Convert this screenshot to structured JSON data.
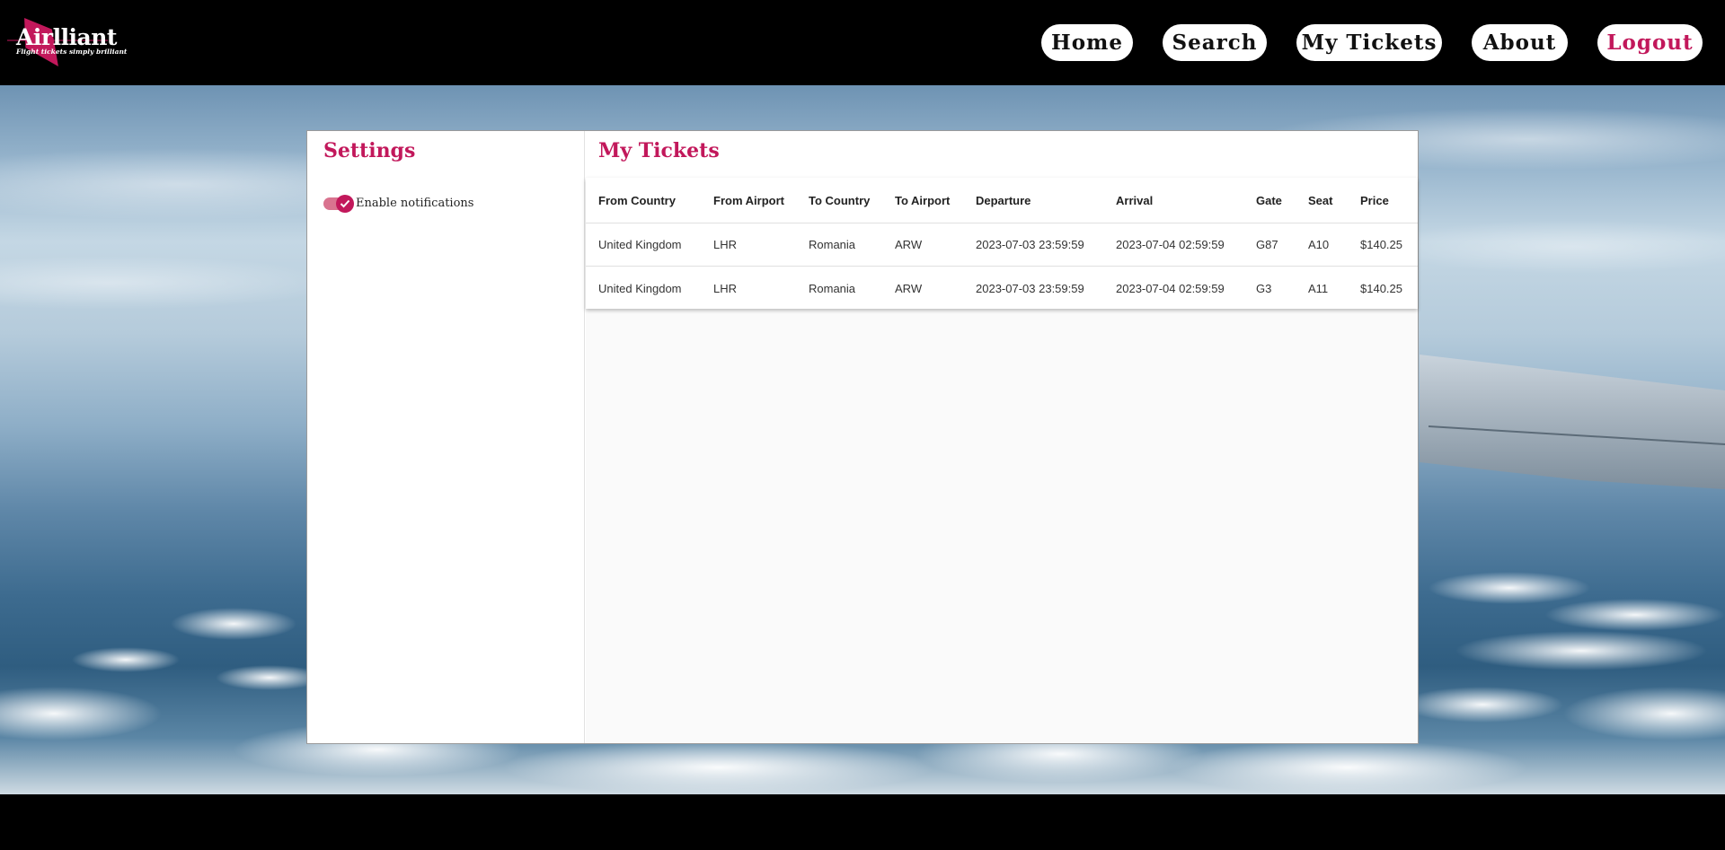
{
  "brand": {
    "name": "Airlliant",
    "tagline": "Flight tickets simply brilliant",
    "accent_color": "#c2185b"
  },
  "nav": {
    "home": "Home",
    "search": "Search",
    "my_tickets": "My Tickets",
    "about": "About",
    "logout": "Logout"
  },
  "settings": {
    "title": "Settings",
    "notifications_label": "Enable notifications",
    "notifications_enabled": true
  },
  "tickets": {
    "title": "My Tickets",
    "columns": [
      "From Country",
      "From Airport",
      "To Country",
      "To Airport",
      "Departure",
      "Arrival",
      "Gate",
      "Seat",
      "Price"
    ],
    "rows": [
      [
        "United Kingdom",
        "LHR",
        "Romania",
        "ARW",
        "2023-07-03 23:59:59",
        "2023-07-04 02:59:59",
        "G87",
        "A10",
        "$140.25"
      ],
      [
        "United Kingdom",
        "LHR",
        "Romania",
        "ARW",
        "2023-07-03 23:59:59",
        "2023-07-04 02:59:59",
        "G3",
        "A11",
        "$140.25"
      ]
    ]
  }
}
